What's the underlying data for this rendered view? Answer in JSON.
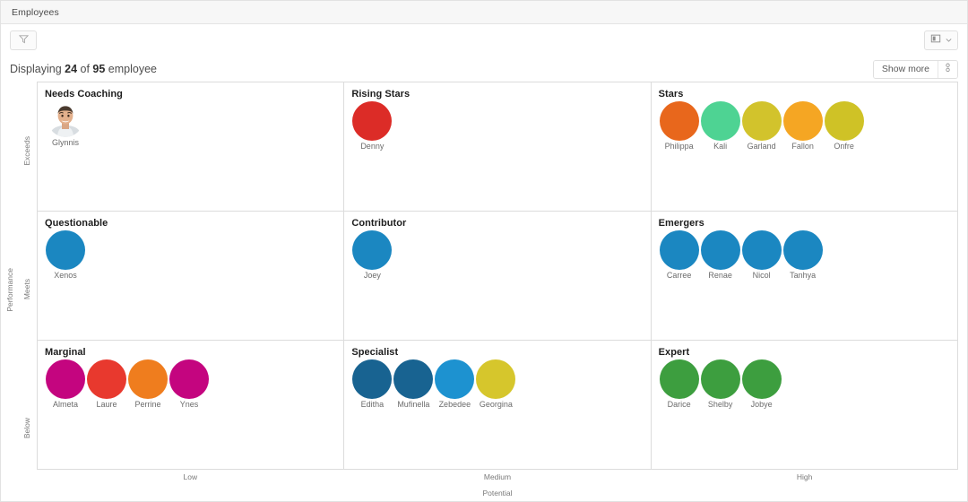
{
  "window": {
    "title": "Employees"
  },
  "toolbar": {
    "filter_icon": "filter-funnel-icon",
    "view_icon": "layout-card-icon",
    "view_chevron_icon": "chevron-down-icon"
  },
  "status": {
    "prefix": "Displaying ",
    "shown": "24",
    "middle": " of ",
    "total": "95",
    "suffix": " employee",
    "show_more_label": "Show more",
    "more_icon": "more-options-icon"
  },
  "axes": {
    "y_title": "Performance",
    "y_ticks": [
      "Exceeds",
      "Meets",
      "Below"
    ],
    "x_title": "Potential",
    "x_ticks": [
      "Low",
      "Medium",
      "High"
    ]
  },
  "colors": {
    "orange": "#E8671C",
    "mint": "#4ED393",
    "olive": "#D2C32C",
    "amber": "#F5A623",
    "olive2": "#CFC226",
    "red": "#DC2C27",
    "blue": "#1B87C1",
    "dark_blue": "#186391",
    "light_blue": "#1D92D0",
    "yellow": "#D6C62C",
    "magenta": "#C4057F",
    "red2": "#E8392E",
    "orange2": "#EF7D1E",
    "green": "#3D9E3F"
  },
  "chart_data": {
    "type": "scatter",
    "title": "Employees",
    "xlabel": "Potential",
    "ylabel": "Performance",
    "x_categories": [
      "Low",
      "Medium",
      "High"
    ],
    "y_categories": [
      "Exceeds",
      "Meets",
      "Below"
    ],
    "cells": [
      {
        "title": "Needs Coaching",
        "row": "Exceeds",
        "col": "Low",
        "people": [
          {
            "name": "Glynnis",
            "avatar": "photo"
          }
        ]
      },
      {
        "title": "Rising Stars",
        "row": "Exceeds",
        "col": "Medium",
        "people": [
          {
            "name": "Denny",
            "color": "#DC2C27"
          }
        ]
      },
      {
        "title": "Stars",
        "row": "Exceeds",
        "col": "High",
        "people": [
          {
            "name": "Philippa",
            "color": "#E8671C"
          },
          {
            "name": "Kali",
            "color": "#4ED393"
          },
          {
            "name": "Garland",
            "color": "#D2C32C"
          },
          {
            "name": "Fallon",
            "color": "#F5A623"
          },
          {
            "name": "Onfre",
            "color": "#CFC226"
          }
        ]
      },
      {
        "title": "Questionable",
        "row": "Meets",
        "col": "Low",
        "people": [
          {
            "name": "Xenos",
            "color": "#1B87C1"
          }
        ]
      },
      {
        "title": "Contributor",
        "row": "Meets",
        "col": "Medium",
        "people": [
          {
            "name": "Joey",
            "color": "#1B87C1"
          }
        ]
      },
      {
        "title": "Emergers",
        "row": "Meets",
        "col": "High",
        "people": [
          {
            "name": "Carree",
            "color": "#1B87C1"
          },
          {
            "name": "Renae",
            "color": "#1B87C1"
          },
          {
            "name": "Nicol",
            "color": "#1B87C1"
          },
          {
            "name": "Tanhya",
            "color": "#1B87C1"
          }
        ]
      },
      {
        "title": "Marginal",
        "row": "Below",
        "col": "Low",
        "people": [
          {
            "name": "Almeta",
            "color": "#C4057F"
          },
          {
            "name": "Laure",
            "color": "#E8392E"
          },
          {
            "name": "Perrine",
            "color": "#EF7D1E"
          },
          {
            "name": "Ynes",
            "color": "#C4057F"
          }
        ]
      },
      {
        "title": "Specialist",
        "row": "Below",
        "col": "Medium",
        "people": [
          {
            "name": "Editha",
            "color": "#186391"
          },
          {
            "name": "Mufinella",
            "color": "#186391"
          },
          {
            "name": "Zebedee",
            "color": "#1D92D0"
          },
          {
            "name": "Georgina",
            "color": "#D6C62C"
          }
        ]
      },
      {
        "title": "Expert",
        "row": "Below",
        "col": "High",
        "people": [
          {
            "name": "Darice",
            "color": "#3D9E3F"
          },
          {
            "name": "Shelby",
            "color": "#3D9E3F"
          },
          {
            "name": "Jobye",
            "color": "#3D9E3F"
          }
        ]
      }
    ]
  }
}
